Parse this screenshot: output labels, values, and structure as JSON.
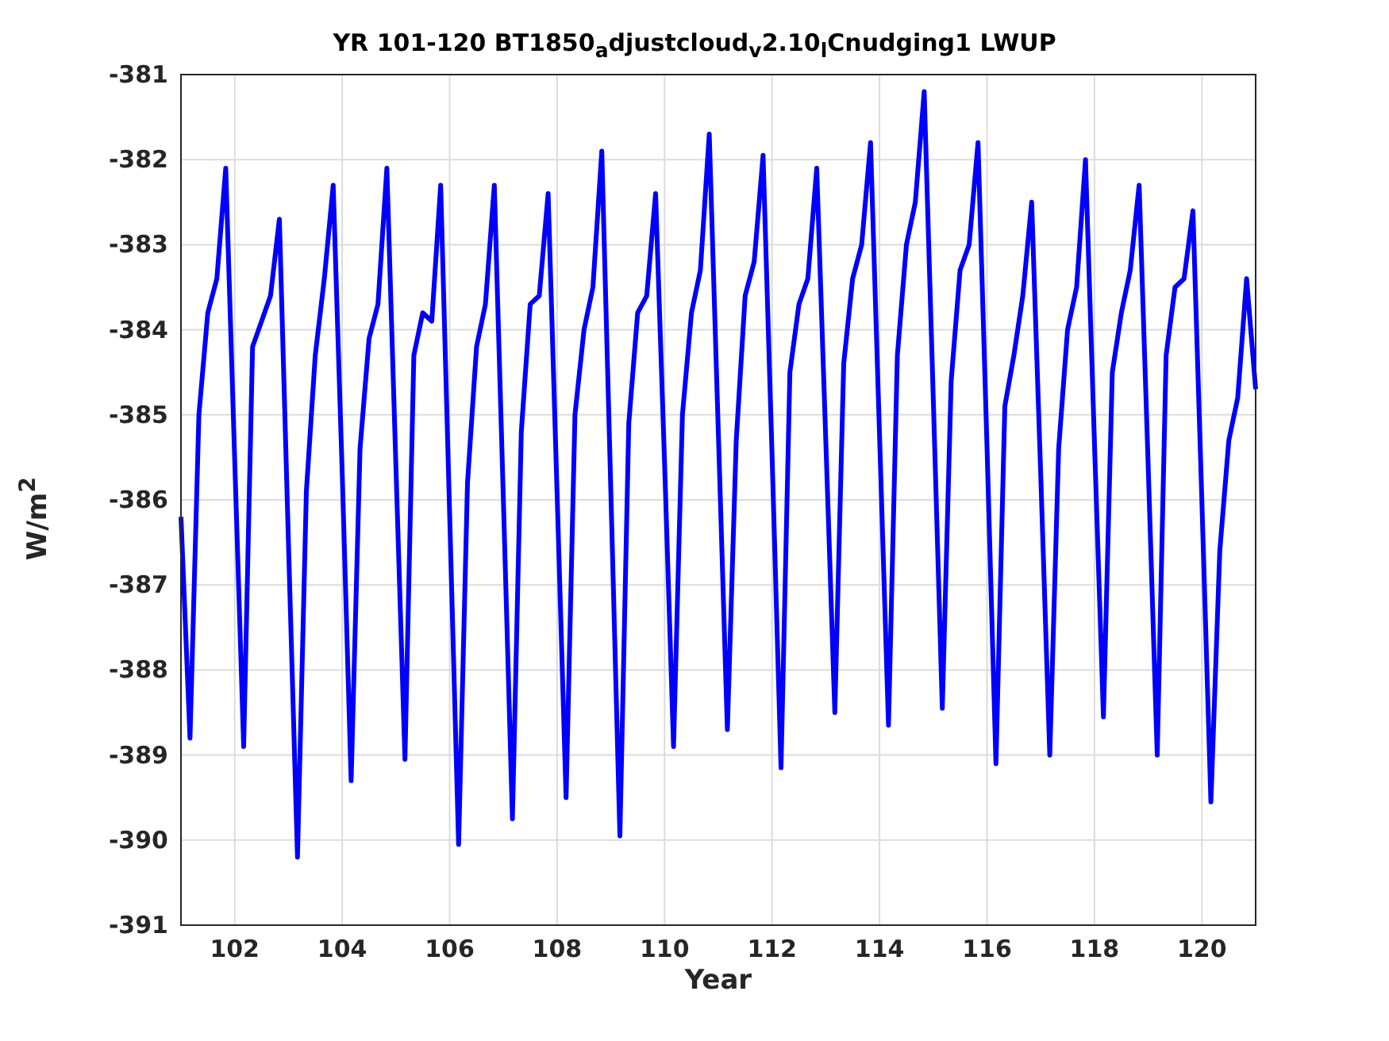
{
  "figure": {
    "chart_data": {
      "type": "line",
      "title": "YR 101-120 BT1850$_{a}$djustcloud$_{v}$2.10$_{l}$Cnudging1 LWUP",
      "xlabel": "Year",
      "ylabel": "W/m$^{2}$",
      "xlim": [
        101,
        121
      ],
      "ylim": [
        -391,
        -381
      ],
      "xticks": [
        102,
        104,
        106,
        108,
        110,
        112,
        114,
        116,
        118,
        120
      ],
      "yticks": [
        -391,
        -390,
        -389,
        -388,
        -387,
        -386,
        -385,
        -384,
        -383,
        -382,
        -381
      ],
      "x": [
        101,
        101.167,
        101.333,
        101.5,
        101.667,
        101.833,
        102,
        102.167,
        102.333,
        102.5,
        102.667,
        102.833,
        103,
        103.167,
        103.333,
        103.5,
        103.667,
        103.833,
        104,
        104.167,
        104.333,
        104.5,
        104.667,
        104.833,
        105,
        105.167,
        105.333,
        105.5,
        105.667,
        105.833,
        106,
        106.167,
        106.333,
        106.5,
        106.667,
        106.833,
        107,
        107.167,
        107.333,
        107.5,
        107.667,
        107.833,
        108,
        108.167,
        108.333,
        108.5,
        108.667,
        108.833,
        109,
        109.167,
        109.333,
        109.5,
        109.667,
        109.833,
        110,
        110.167,
        110.333,
        110.5,
        110.667,
        110.833,
        111,
        111.167,
        111.333,
        111.5,
        111.667,
        111.833,
        112,
        112.167,
        112.333,
        112.5,
        112.667,
        112.833,
        113,
        113.167,
        113.333,
        113.5,
        113.667,
        113.833,
        114,
        114.167,
        114.333,
        114.5,
        114.667,
        114.833,
        115,
        115.167,
        115.333,
        115.5,
        115.667,
        115.833,
        116,
        116.167,
        116.333,
        116.5,
        116.667,
        116.833,
        117,
        117.167,
        117.333,
        117.5,
        117.667,
        117.833,
        118,
        118.167,
        118.333,
        118.5,
        118.667,
        118.833,
        119,
        119.167,
        119.333,
        119.5,
        119.667,
        119.833,
        120,
        120.167,
        120.333,
        120.5,
        120.667,
        120.833,
        121
      ],
      "grid": true,
      "series": [
        {
          "color": "#0000ff",
          "values": [
            -386.2,
            -388.8,
            -385.0,
            -383.8,
            -383.4,
            -382.1,
            -385.5,
            -388.9,
            -384.2,
            -383.9,
            -383.6,
            -382.7,
            -386.5,
            -390.2,
            -385.9,
            -384.3,
            -383.4,
            -382.3,
            -385.7,
            -389.3,
            -385.4,
            -384.1,
            -383.7,
            -382.1,
            -385.6,
            -389.05,
            -384.3,
            -383.8,
            -383.9,
            -382.3,
            -386.2,
            -390.05,
            -385.8,
            -384.2,
            -383.7,
            -382.3,
            -386.0,
            -389.75,
            -385.2,
            -383.7,
            -383.6,
            -382.4,
            -385.9,
            -389.5,
            -385.0,
            -384.0,
            -383.5,
            -381.9,
            -385.9,
            -389.95,
            -385.1,
            -383.8,
            -383.6,
            -382.4,
            -385.6,
            -388.9,
            -385.0,
            -383.8,
            -383.3,
            -381.7,
            -385.2,
            -388.7,
            -385.3,
            -383.6,
            -383.2,
            -381.95,
            -385.5,
            -389.15,
            -384.5,
            -383.7,
            -383.4,
            -382.1,
            -385.3,
            -388.5,
            -384.4,
            -383.4,
            -383.0,
            -381.8,
            -385.2,
            -388.65,
            -384.3,
            -383.0,
            -382.5,
            -381.2,
            -384.8,
            -388.45,
            -384.6,
            -383.3,
            -383.0,
            -381.8,
            -385.4,
            -389.1,
            -384.9,
            -384.3,
            -383.6,
            -382.5,
            -385.7,
            -389.0,
            -385.4,
            -384.0,
            -383.5,
            -382.0,
            -385.3,
            -388.55,
            -384.5,
            -383.8,
            -383.3,
            -382.3,
            -385.6,
            -389.0,
            -384.3,
            -383.5,
            -383.4,
            -382.6,
            -386.0,
            -389.55,
            -386.6,
            -385.3,
            -384.8,
            -383.4,
            -384.7
          ]
        }
      ]
    }
  }
}
